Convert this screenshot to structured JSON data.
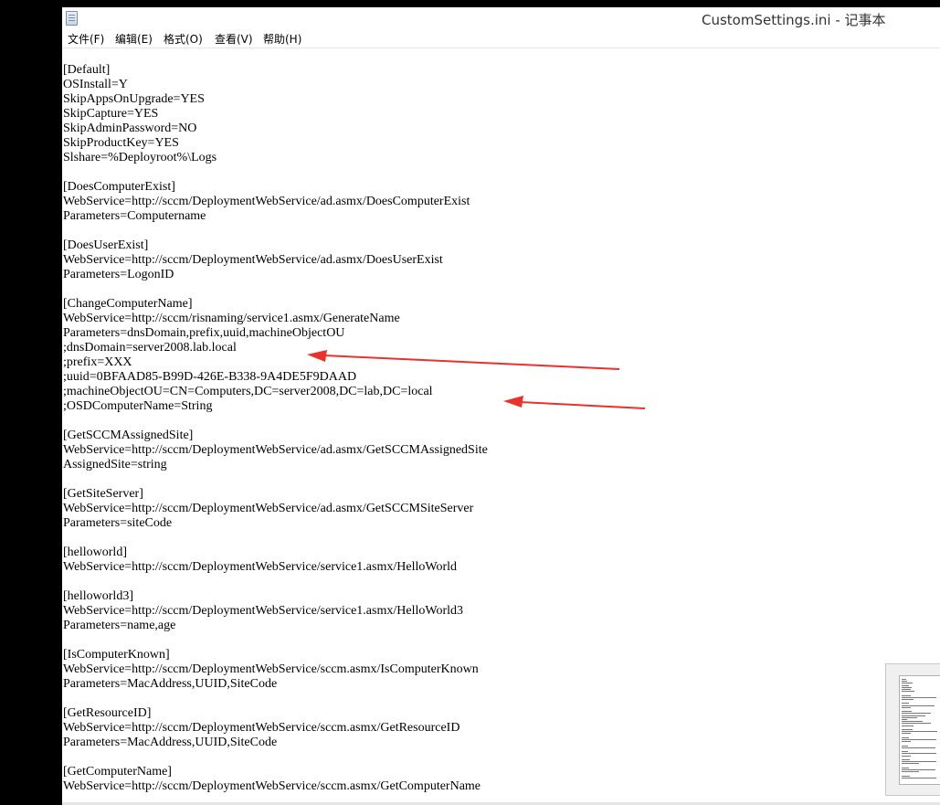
{
  "window": {
    "title": "CustomSettings.ini - 记事本"
  },
  "menu": {
    "items": [
      "文件(F)",
      "编辑(E)",
      "格式(O)",
      "查看(V)",
      "帮助(H)"
    ]
  },
  "document": {
    "lines": [
      "[Default]",
      "OSInstall=Y",
      "SkipAppsOnUpgrade=YES",
      "SkipCapture=YES",
      "SkipAdminPassword=NO",
      "SkipProductKey=YES",
      "Slshare=%Deployroot%\\Logs",
      "",
      "[DoesComputerExist]",
      "WebService=http://sccm/DeploymentWebService/ad.asmx/DoesComputerExist",
      "Parameters=Computername",
      "",
      "[DoesUserExist]",
      "WebService=http://sccm/DeploymentWebService/ad.asmx/DoesUserExist",
      "Parameters=LogonID",
      "",
      "[ChangeComputerName]",
      "WebService=http://sccm/risnaming/service1.asmx/GenerateName",
      "Parameters=dnsDomain,prefix,uuid,machineObjectOU",
      ";dnsDomain=server2008.lab.local",
      ";prefix=XXX",
      ";uuid=0BFAAD85-B99D-426E-B338-9A4DE5F9DAAD",
      ";machineObjectOU=CN=Computers,DC=server2008,DC=lab,DC=local",
      ";OSDComputerName=String",
      "",
      "[GetSCCMAssignedSite]",
      "WebService=http://sccm/DeploymentWebService/ad.asmx/GetSCCMAssignedSite",
      "AssignedSite=string",
      "",
      "[GetSiteServer]",
      "WebService=http://sccm/DeploymentWebService/ad.asmx/GetSCCMSiteServer",
      "Parameters=siteCode",
      "",
      "[helloworld]",
      "WebService=http://sccm/DeploymentWebService/service1.asmx/HelloWorld",
      "",
      "[helloworld3]",
      "WebService=http://sccm/DeploymentWebService/service1.asmx/HelloWorld3",
      "Parameters=name,age",
      "",
      "[IsComputerKnown]",
      "WebService=http://sccm/DeploymentWebService/sccm.asmx/IsComputerKnown",
      "Parameters=MacAddress,UUID,SiteCode",
      "",
      "[GetResourceID]",
      "WebService=http://sccm/DeploymentWebService/sccm.asmx/GetResourceID",
      "Parameters=MacAddress,UUID,SiteCode",
      "",
      "[GetComputerName]",
      "WebService=http://sccm/DeploymentWebService/sccm.asmx/GetComputerName"
    ]
  },
  "annotations": {
    "arrow_color": "#e8322b",
    "arrow_targets": [
      "dnsDomain-line",
      "machineObjectOU-line"
    ]
  },
  "colors": {
    "background": "#ffffff",
    "text": "#000000",
    "outside": "#000000"
  }
}
